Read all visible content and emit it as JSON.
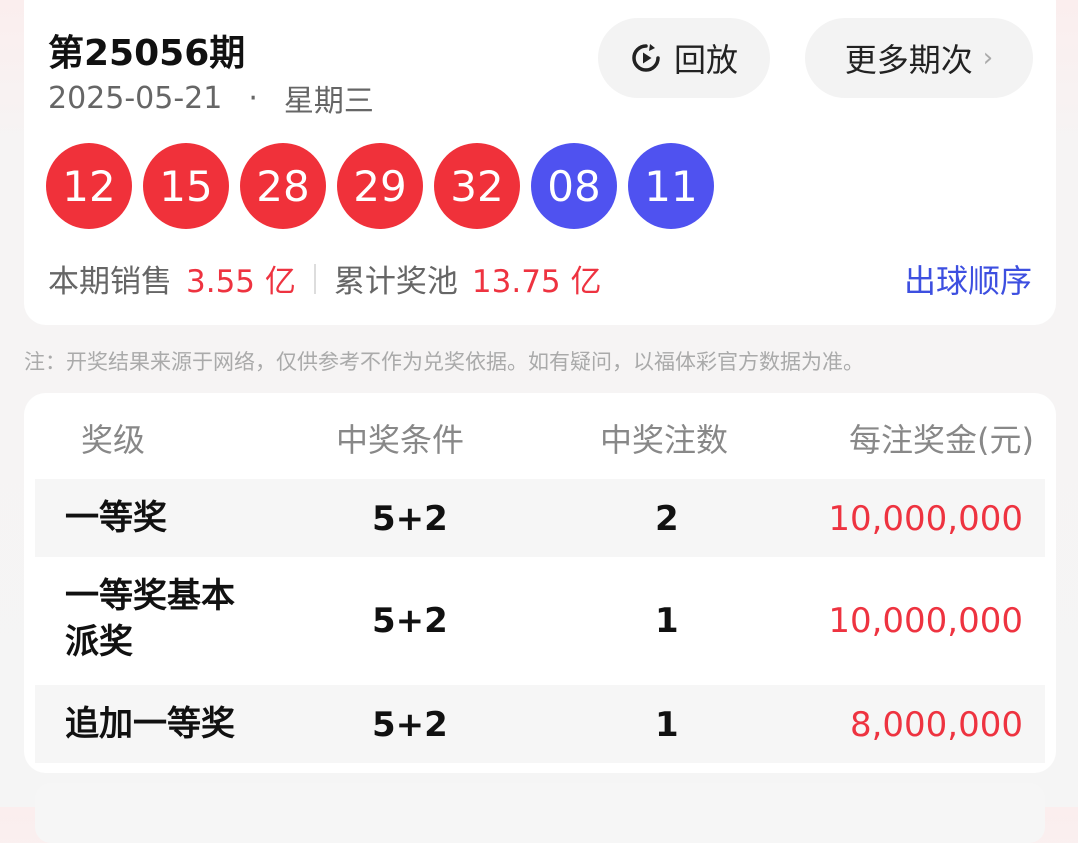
{
  "draw": {
    "issue": "第25056期",
    "date": "2025-05-21",
    "separator": "·",
    "weekday": "星期三",
    "replay_label": "回放",
    "more_label": "更多期次",
    "front_balls": [
      "12",
      "15",
      "28",
      "29",
      "32"
    ],
    "back_balls": [
      "08",
      "11"
    ],
    "sales_label": "本期销售",
    "sales_value": "3.55 亿",
    "pool_label": "累计奖池",
    "pool_value": "13.75 亿",
    "order_link": "出球顺序"
  },
  "note": "注：开奖结果来源于网络，仅供参考不作为兑奖依据。如有疑问，以福体彩官方数据为准。",
  "prize_table": {
    "headers": [
      "奖级",
      "中奖条件",
      "中奖注数",
      "每注奖金(元)"
    ],
    "rows": [
      {
        "level": "一等奖",
        "condition": "5+2",
        "count": "2",
        "amount": "10,000,000"
      },
      {
        "level_line1": "一等奖基本",
        "level_line2": "派奖",
        "condition": "5+2",
        "count": "1",
        "amount": "10,000,000"
      },
      {
        "level": "追加一等奖",
        "condition": "5+2",
        "count": "1",
        "amount": "8,000,000"
      }
    ]
  },
  "colors": {
    "red_ball": "#f0313a",
    "blue_ball": "#4f52f0",
    "accent_red": "#ee3340",
    "link_blue": "#3d4fe0"
  },
  "icons": {
    "replay": "replay-icon",
    "more": "chevron-right-icon"
  }
}
